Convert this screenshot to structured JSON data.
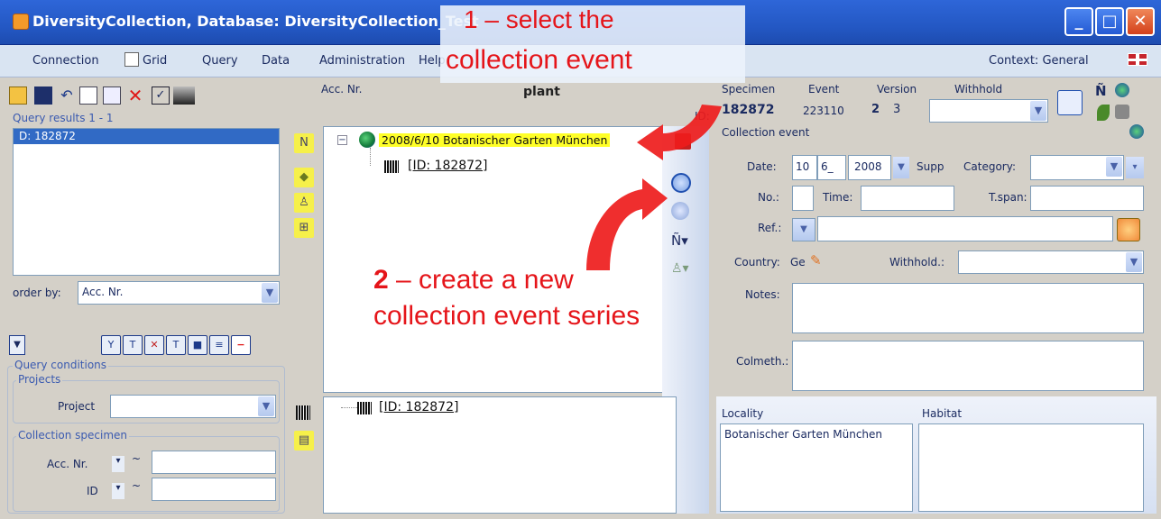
{
  "window": {
    "title": "DiversityCollection, Database: DiversityCollection_Test",
    "minimize_glyph": "_",
    "maximize_glyph": "□",
    "close_glyph": "✕"
  },
  "menu": {
    "items": [
      "Connection",
      "Grid",
      "Query",
      "Data",
      "Administration",
      "Help"
    ],
    "context": "Context: General"
  },
  "left": {
    "query_results_label": "Query results  1 - 1",
    "result_item": "D: 182872",
    "order_by_label": "order by:",
    "order_by_value": "Acc. Nr.",
    "query_conditions_label": "Query conditions",
    "projects_label": "Projects",
    "project_label": "Project",
    "collection_specimen_label": "Collection specimen",
    "acc_nr_label": "Acc. Nr.",
    "id_label": "ID",
    "operator_glyph": "▾",
    "approx_glyph": "~"
  },
  "center": {
    "acc_nr_label": "Acc. Nr.",
    "plant_label": "plant",
    "id_label": "ID:",
    "tree_event": "2008/6/10 Botanischer Garten München",
    "tree_id": "[ID: 182872]",
    "part_id": "[ID: 182872]"
  },
  "right": {
    "specimen_label": "Specimen",
    "event_label": "Event",
    "version_label": "Version",
    "withhold_label": "Withhold",
    "specimen_id": "182872",
    "event_id": "223110",
    "version_a": "2",
    "version_b": "3",
    "collection_event_label": "Collection event",
    "date_label": "Date:",
    "date_day": "10",
    "date_month": "6_",
    "date_year": "2008",
    "supp_label": "Supp",
    "category_label": "Category:",
    "no_label": "No.:",
    "time_label": "Time:",
    "tspan_label": "T.span:",
    "ref_label": "Ref.:",
    "country_label": "Country:",
    "country_value": "Ge",
    "withhold2_label": "Withhold.:",
    "notes_label": "Notes:",
    "colmeth_label": "Colmeth.:",
    "locality_label": "Locality",
    "habitat_label": "Habitat",
    "locality_value": "Botanischer Garten München"
  },
  "callouts": {
    "c1_line1": "1 – select the",
    "c1_line2": "collection event",
    "c2_num": "2",
    "c2_line1": " – create a new",
    "c2_line2": "collection event series"
  },
  "colors": {
    "title_blue": "#2458c4",
    "selection": "#316ac5",
    "highlight": "#ffff28",
    "callout_red": "#e5151a"
  }
}
